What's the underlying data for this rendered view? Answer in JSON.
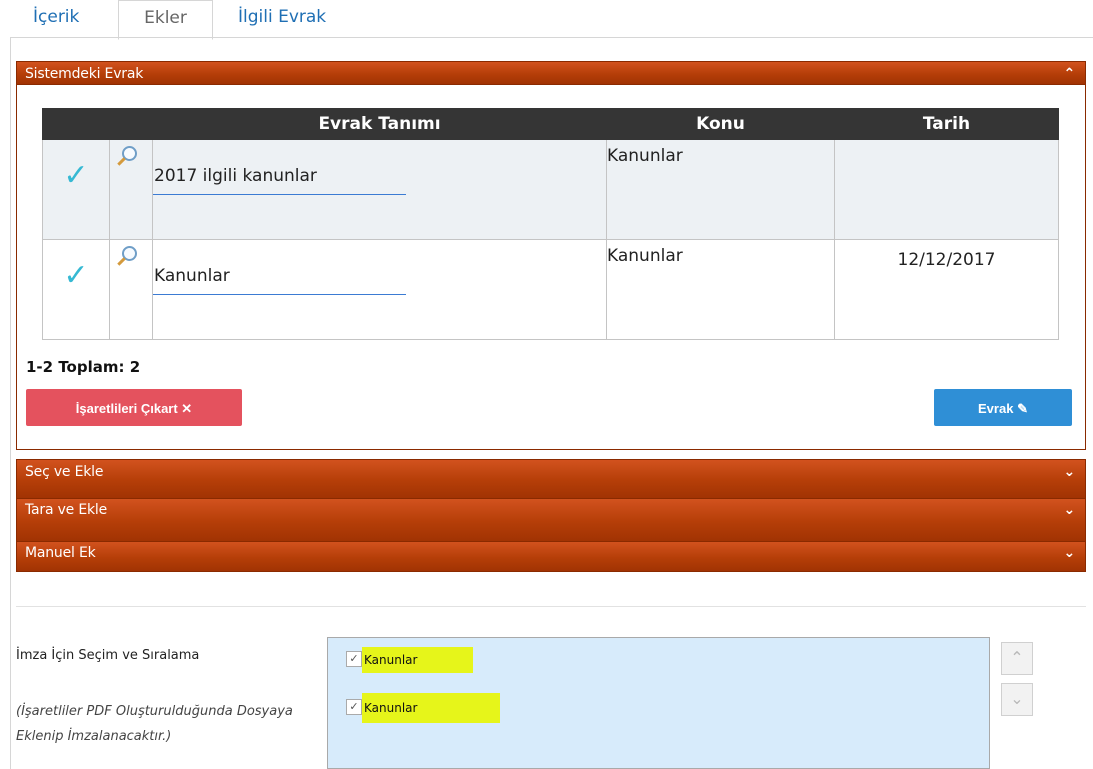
{
  "tabs": [
    {
      "label": "İçerik"
    },
    {
      "label": "Ekler",
      "active": true
    },
    {
      "label": "İlgili Evrak"
    }
  ],
  "panels": {
    "sistemdeki": {
      "title": "Sistemdeki Evrak",
      "icon": "chevron-up-icon",
      "expanded": true
    },
    "sec_ekle": {
      "title": "Seç ve Ekle",
      "icon": "chevron-down-icon"
    },
    "tara_ekle": {
      "title": "Tara ve Ekle",
      "icon": "chevron-down-icon"
    },
    "manuel_ek": {
      "title": "Manuel Ek",
      "icon": "chevron-down-icon"
    }
  },
  "table": {
    "headers": {
      "evrak_tanimi": "Evrak Tanımı",
      "konu": "Konu",
      "tarih": "Tarih"
    },
    "rows": [
      {
        "evrak_tanimi": "2017 ilgili kanunlar",
        "konu": "Kanunlar",
        "tarih": "",
        "checked": true
      },
      {
        "evrak_tanimi": "Kanunlar",
        "konu": "Kanunlar",
        "tarih": "12/12/2017",
        "checked": true
      }
    ]
  },
  "total_text": "1-2 Toplam: 2",
  "buttons": {
    "remove_marked": "İşaretlileri Çıkart ✕",
    "evrak": "Evrak"
  },
  "signature": {
    "label": "İmza İçin Seçim ve Sıralama",
    "note": "(İşaretliler PDF Oluşturulduğunda Dosyaya Eklenip İmzalanacaktır.)",
    "items": [
      {
        "label": "Kanunlar",
        "checked": true,
        "highlighted": true
      },
      {
        "label": "Kanunlar",
        "checked": true,
        "highlighted": true
      }
    ]
  },
  "colors": {
    "panel_header": "#b53e08",
    "header_dark": "#353535",
    "check": "#36b9d3",
    "remove_button": "#e4525e",
    "evrak_button": "#2f8fd6",
    "listbox_bg": "#d7ebfb",
    "highlight": "#e6f51a"
  }
}
